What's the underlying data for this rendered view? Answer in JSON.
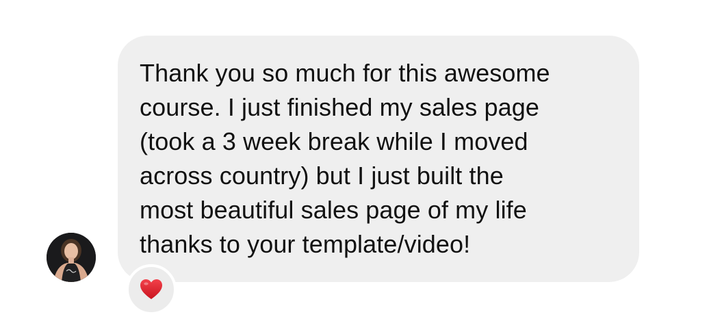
{
  "message": {
    "text": "Thank you so much for this awesome\ncourse. I just finished my sales page\n(took a 3 week break while I moved\nacross country) but I just built the\nmost beautiful sales page of my life\nthanks to your template/video!",
    "bubble_color": "#efefef",
    "text_color": "#111111"
  },
  "sender": {
    "avatar_icon": "profile-photo"
  },
  "reaction": {
    "icon": "heart-icon",
    "color": "#e0242f"
  }
}
